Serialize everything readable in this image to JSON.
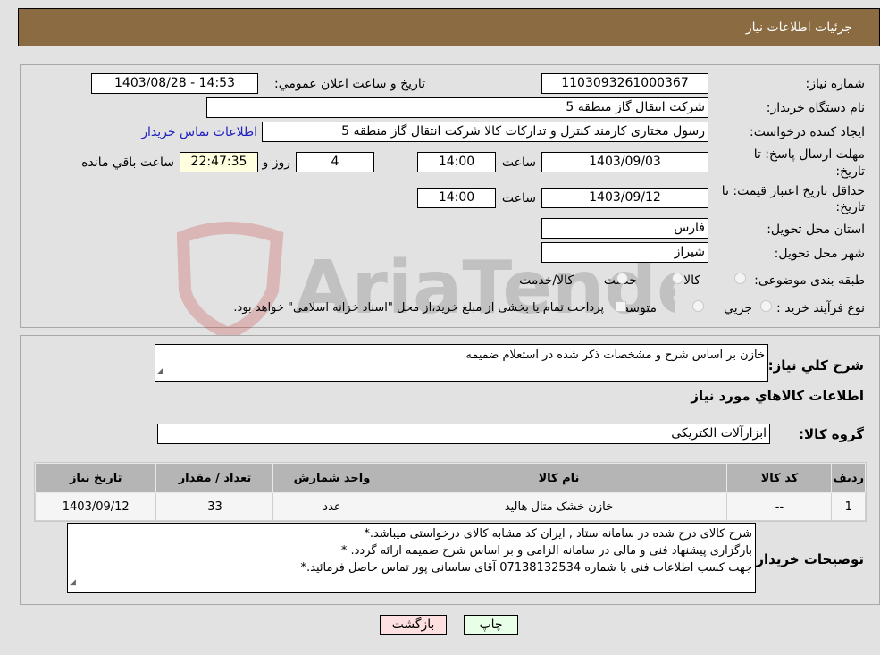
{
  "header": {
    "title": "جزئیات اطلاعات نیاز"
  },
  "form": {
    "need_number": {
      "label": "شماره نیاز:",
      "value": "1103093261000367"
    },
    "announce": {
      "label": "تاريخ و ساعت اعلان عمومي:",
      "value": "1403/08/28 - 14:53"
    },
    "buyer_org": {
      "label": "نام دستگاه خريدار:",
      "value": "شرکت انتقال گاز منطقه 5"
    },
    "requester": {
      "label": "ايجاد کننده درخواست:",
      "value": "رسول  مختاری کارمند کنترل و تدارکات کالا شرکت انتقال گاز منطقه 5",
      "contact_link": "اطلاعات تماس خریدار"
    },
    "response_deadline": {
      "label_line1": "مهلت ارسال پاسخ: تا",
      "label_line2": "تاريخ:",
      "date": "1403/09/03",
      "time_label": "ساعت",
      "time": "14:00",
      "days": "4",
      "days_label": "روز و",
      "remaining": "22:47:35",
      "remaining_label": "ساعت باقي مانده"
    },
    "price_validity": {
      "label_line1": "حداقل تاريخ اعتبار قيمت: تا",
      "label_line2": "تاريخ:",
      "date": "1403/09/12",
      "time_label": "ساعت",
      "time": "14:00"
    },
    "province": {
      "label": "استان محل تحويل:",
      "value": "فارس"
    },
    "city": {
      "label": "شهر محل تحويل:",
      "value": "شیراز"
    },
    "category": {
      "label": "طبقه بندی موضوعی:",
      "options": [
        "کالا",
        "خدمت",
        "کالا/خدمت"
      ]
    },
    "process": {
      "label": "نوع فرآيند خريد :",
      "options": [
        "جزيي",
        "متوسط"
      ],
      "treasury_note": "پرداخت تمام يا بخشی از مبلغ خريد،از محل \"اسناد خزانه اسلامی\" خواهد بود."
    }
  },
  "details": {
    "summary_label": "شرح كلي نياز:",
    "summary_value": "خازن بر اساس شرح و مشخصات ذکر شده در استعلام ضمیمه",
    "goods_heading": "اطلاعات كالاهاي مورد نياز",
    "group_label": "گروه كالا:",
    "group_value": "ابزارآلات الکتریکی",
    "table": {
      "headers": [
        "رديف",
        "كد كالا",
        "نام كالا",
        "واحد شمارش",
        "تعداد / مقدار",
        "تاريخ نياز"
      ],
      "rows": [
        [
          "1",
          "--",
          "خازن خشک متال هالید",
          "عدد",
          "33",
          "1403/09/12"
        ]
      ]
    },
    "buyer_notes_label": "توضيحات خريدار:",
    "buyer_notes": [
      "شرح کالای درج شده در سامانه ستاد , ایران کد مشابه کالای درخواستی میباشد.*",
      " بارگزاری پیشنهاد فنی و مالی در سامانه الزامی و بر اساس شرح ضمیمه ارائه گردد. *",
      "جهت کسب اطلاعات فنی با شماره 07138132534 آقای ساسانی پور تماس حاصل فرمائید.*"
    ]
  },
  "buttons": {
    "print": "چاپ",
    "back": "بازگشت"
  },
  "colors": {
    "header_bg": "#8b6b42",
    "back_bg": "#ffe0e0",
    "print_bg": "#e8ffe8",
    "remaining_bg": "#ffffe0",
    "link": "#2020c0"
  },
  "watermark": {
    "text": "AriaTender.neT"
  }
}
